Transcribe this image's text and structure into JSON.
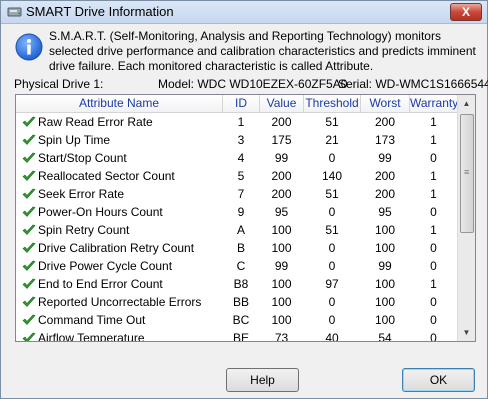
{
  "window": {
    "title": "SMART Drive Information",
    "close_glyph": "X"
  },
  "info_text": "S.M.A.R.T. (Self-Monitoring, Analysis and Reporting Technology) monitors selected drive performance and calibration characteristics and predicts imminent drive failure. Each monitored characteristic is called Attribute.",
  "drive": {
    "label": "Physical Drive 1:",
    "model": "Model: WDC WD10EZEX-60ZF5A0",
    "serial": "Serial: WD-WMC1S1666544"
  },
  "table": {
    "columns": [
      "Attribute Name",
      "ID",
      "Value",
      "Threshold",
      "Worst",
      "Warranty"
    ],
    "rows": [
      {
        "name": "Raw Read Error Rate",
        "id": "1",
        "value": "200",
        "threshold": "51",
        "worst": "200",
        "warranty": "1"
      },
      {
        "name": "Spin Up Time",
        "id": "3",
        "value": "175",
        "threshold": "21",
        "worst": "173",
        "warranty": "1"
      },
      {
        "name": "Start/Stop Count",
        "id": "4",
        "value": "99",
        "threshold": "0",
        "worst": "99",
        "warranty": "0"
      },
      {
        "name": "Reallocated Sector Count",
        "id": "5",
        "value": "200",
        "threshold": "140",
        "worst": "200",
        "warranty": "1"
      },
      {
        "name": "Seek Error Rate",
        "id": "7",
        "value": "200",
        "threshold": "51",
        "worst": "200",
        "warranty": "1"
      },
      {
        "name": "Power-On Hours Count",
        "id": "9",
        "value": "95",
        "threshold": "0",
        "worst": "95",
        "warranty": "0"
      },
      {
        "name": "Spin Retry Count",
        "id": "A",
        "value": "100",
        "threshold": "51",
        "worst": "100",
        "warranty": "1"
      },
      {
        "name": "Drive Calibration Retry Count",
        "id": "B",
        "value": "100",
        "threshold": "0",
        "worst": "100",
        "warranty": "0"
      },
      {
        "name": "Drive Power Cycle Count",
        "id": "C",
        "value": "99",
        "threshold": "0",
        "worst": "99",
        "warranty": "0"
      },
      {
        "name": "End to End Error Count",
        "id": "B8",
        "value": "100",
        "threshold": "97",
        "worst": "100",
        "warranty": "1"
      },
      {
        "name": "Reported Uncorrectable Errors",
        "id": "BB",
        "value": "100",
        "threshold": "0",
        "worst": "100",
        "warranty": "0"
      },
      {
        "name": "Command Time Out",
        "id": "BC",
        "value": "100",
        "threshold": "0",
        "worst": "100",
        "warranty": "0"
      },
      {
        "name": "Airflow Temperature",
        "id": "BE",
        "value": "73",
        "threshold": "40",
        "worst": "54",
        "warranty": "0"
      }
    ]
  },
  "buttons": {
    "help": "Help",
    "ok": "OK"
  },
  "colors": {
    "header_text": "#1c3aa8",
    "check": "#2e9e2e"
  },
  "icons": {
    "title": "drive-icon",
    "info": "info-icon",
    "status": "check-icon"
  }
}
